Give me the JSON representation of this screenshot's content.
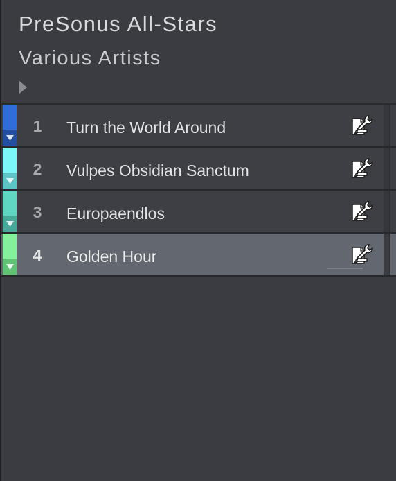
{
  "album": {
    "title": "PreSonus All-Stars",
    "artist": "Various Artists"
  },
  "tracks": [
    {
      "number": "1",
      "name": "Turn the World Around",
      "color": "#2f6ed8",
      "collapse_color": "#234fa0",
      "selected": false
    },
    {
      "number": "2",
      "name": "Vulpes Obsidian Sanctum",
      "color": "#7cf7f7",
      "collapse_color": "#5cc4c4",
      "selected": false
    },
    {
      "number": "3",
      "name": "Europaendlos",
      "color": "#5fd6c2",
      "collapse_color": "#47a999",
      "selected": false
    },
    {
      "number": "4",
      "name": "Golden Hour",
      "color": "#83f09b",
      "collapse_color": "#60c275",
      "selected": true
    }
  ],
  "icons": {
    "expand": "triangle-right-icon",
    "collapse": "triangle-down-icon",
    "track_tool": "wrench-edit-icon"
  }
}
